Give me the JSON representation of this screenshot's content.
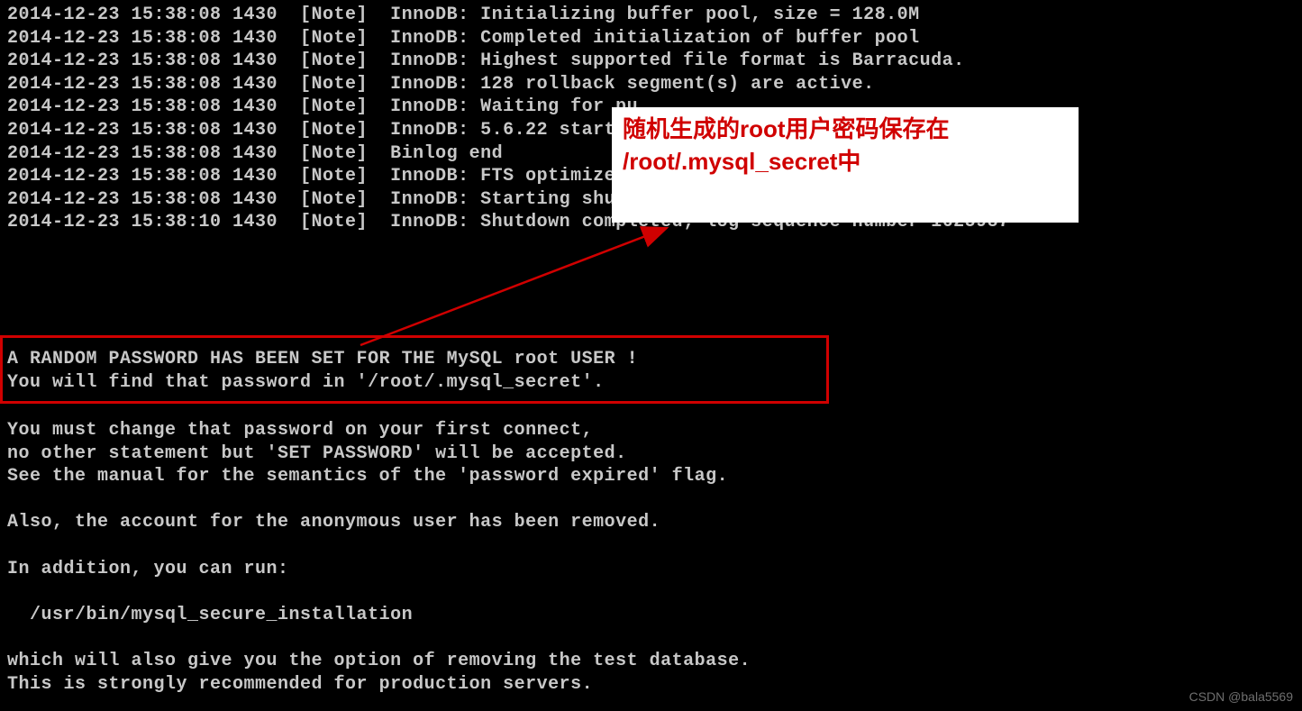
{
  "log_lines": [
    "2014-12-23 15:38:08 1430  [Note]  InnoDB: Initializing buffer pool, size = 128.0M",
    "2014-12-23 15:38:08 1430  [Note]  InnoDB: Completed initialization of buffer pool",
    "2014-12-23 15:38:08 1430  [Note]  InnoDB: Highest supported file format is Barracuda.",
    "2014-12-23 15:38:08 1430  [Note]  InnoDB: 128 rollback segment(s) are active.",
    "2014-12-23 15:38:08 1430  [Note]  InnoDB: Waiting for pu",
    "2014-12-23 15:38:08 1430  [Note]  InnoDB: 5.6.22 started",
    "2014-12-23 15:38:08 1430  [Note]  Binlog end",
    "2014-12-23 15:38:08 1430  [Note]  InnoDB: FTS optimize t",
    "2014-12-23 15:38:08 1430  [Note]  InnoDB: Starting shutd",
    "2014-12-23 15:38:10 1430  [Note]  InnoDB: Shutdown completed; log sequence number 1625987"
  ],
  "boxed_lines": [
    "A RANDOM PASSWORD HAS BEEN SET FOR THE MySQL root USER !",
    "You will find that password in '/root/.mysql_secret'."
  ],
  "post_lines": [
    "You must change that password on your first connect,",
    "no other statement but 'SET PASSWORD' will be accepted.",
    "See the manual for the semantics of the 'password expired' flag.",
    "",
    "Also, the account for the anonymous user has been removed.",
    "",
    "In addition, you can run:",
    "",
    "  /usr/bin/mysql_secure_installation",
    "",
    "which will also give you the option of removing the test database.",
    "This is strongly recommended for production servers."
  ],
  "annotation": {
    "line1": "随机生成的root用户密码保存在",
    "line2": "/root/.mysql_secret中"
  },
  "watermark": "CSDN @bala5569"
}
